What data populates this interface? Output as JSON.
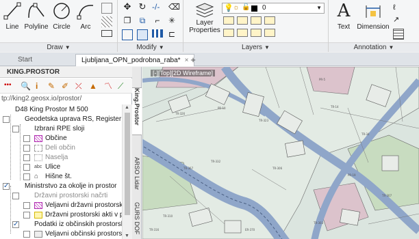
{
  "ribbon": {
    "draw": {
      "title": "Draw",
      "line": "Line",
      "polyline": "Polyline",
      "circle": "Circle",
      "arc": "Arc"
    },
    "modify": {
      "title": "Modify"
    },
    "layers": {
      "title": "Layers",
      "layer_properties": "Layer Properties",
      "current_layer": "0"
    },
    "annotation": {
      "title": "Annotation",
      "text": "Text",
      "dimension": "Dimension"
    }
  },
  "tabs": [
    {
      "label": "Start"
    },
    {
      "label": "Ljubljana_OPN_podrobna_raba*"
    }
  ],
  "palette": {
    "title": "KING.PROSTOR",
    "url": "tp://king2.geosx.io/prostor/",
    "items": [
      {
        "label": "D48 King Prostor M 500"
      },
      {
        "label": "Geodetska uprava RS, Register prost"
      },
      {
        "label": "Izbrani RPE sloji"
      },
      {
        "label": "Občine"
      },
      {
        "label": "Deli občin"
      },
      {
        "label": "Naselja"
      },
      {
        "label": "Ulice"
      },
      {
        "label": "Hišne št."
      },
      {
        "label": "Ministrstvo za okolje in prostor"
      },
      {
        "label": "Državni prostorski načrti"
      },
      {
        "label": "Veljavni državni prostorski a"
      },
      {
        "label": "Državni prostorski akti v prip"
      },
      {
        "label": "Podatki iz občinskih prostorskih"
      },
      {
        "label": "Veljavni občinski prostorski"
      }
    ]
  },
  "sidetabs": [
    "King.Prostor",
    "ARSO Lidar",
    "GURS DOF"
  ],
  "viewport": {
    "label": "[-][Top][2D Wireframe]"
  },
  "colors": {
    "ribbon_bg": "#f5f6f7",
    "map_road": "#8fa6c9",
    "map_pink": "#dcc3cc",
    "map_green": "#c8dcc0"
  }
}
